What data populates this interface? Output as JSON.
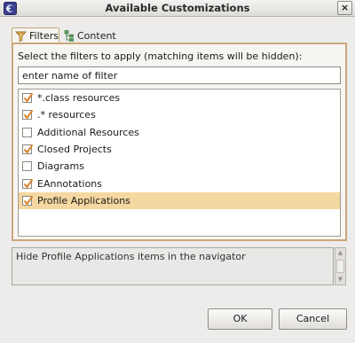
{
  "window": {
    "title": "Available Customizations",
    "close_glyph": "×",
    "app_icon": "eclipse-app-icon"
  },
  "tabs": [
    {
      "label": "Filters",
      "icon": "filter-icon",
      "active": true
    },
    {
      "label": "Content",
      "icon": "content-tree-icon",
      "active": false
    }
  ],
  "filters_panel": {
    "instruction": "Select the filters to apply (matching items will be hidden):",
    "search": {
      "value": "enter name of filter",
      "placeholder": "enter name of filter"
    },
    "items": [
      {
        "label": "*.class resources",
        "checked": true,
        "selected": false
      },
      {
        "label": ".* resources",
        "checked": true,
        "selected": false
      },
      {
        "label": "Additional Resources",
        "checked": false,
        "selected": false
      },
      {
        "label": "Closed Projects",
        "checked": true,
        "selected": false
      },
      {
        "label": "Diagrams",
        "checked": false,
        "selected": false
      },
      {
        "label": "EAnnotations",
        "checked": true,
        "selected": false
      },
      {
        "label": "Profile Applications",
        "checked": true,
        "selected": true
      }
    ]
  },
  "description": "Hide Profile Applications items in the navigator",
  "buttons": {
    "ok": "OK",
    "cancel": "Cancel"
  },
  "colors": {
    "accent_border": "#c9a77b",
    "selection": "#f5d8a1",
    "check": "#d9832a"
  }
}
